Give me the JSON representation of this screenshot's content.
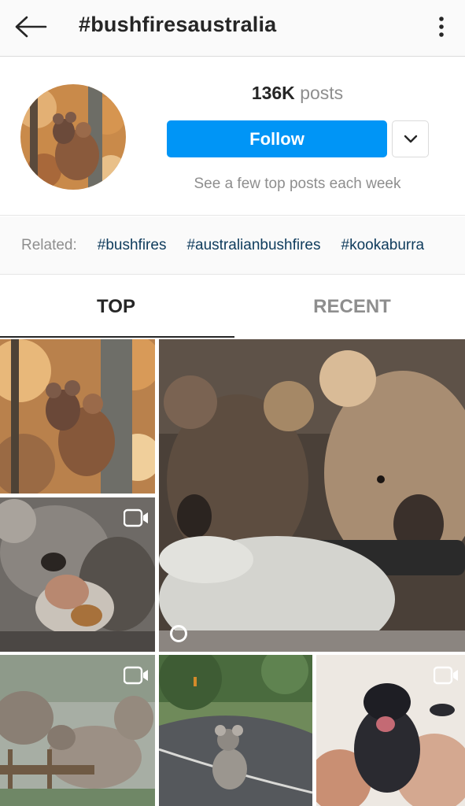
{
  "appbar": {
    "title": "#bushfiresaustralia",
    "back_icon": "arrow-left-icon",
    "more_icon": "more-vertical-icon"
  },
  "header": {
    "post_count": "136K",
    "post_label": "posts",
    "follow_label": "Follow",
    "dropdown_icon": "chevron-down-icon",
    "subtext": "See a few top posts each week"
  },
  "related": {
    "label": "Related:",
    "tags": [
      "#bushfires",
      "#australianbushfires",
      "#kookaburra"
    ]
  },
  "tabs": {
    "top": "TOP",
    "recent": "RECENT"
  },
  "grid": {
    "posts": [
      {
        "subject": "koalas climbing tree"
      },
      {
        "subject": "koala joeys with gloved hand",
        "video": true
      },
      {
        "subject": "koala mother with joey",
        "video": true
      },
      {
        "subject": "elephants in mist",
        "video": true
      },
      {
        "subject": "koala on road",
        "video": false
      },
      {
        "subject": "baby echidna in hand",
        "video": true
      }
    ]
  },
  "colors": {
    "accent": "#0095f6",
    "related_tag": "#0e3b5c",
    "muted": "#8e8e8e"
  }
}
